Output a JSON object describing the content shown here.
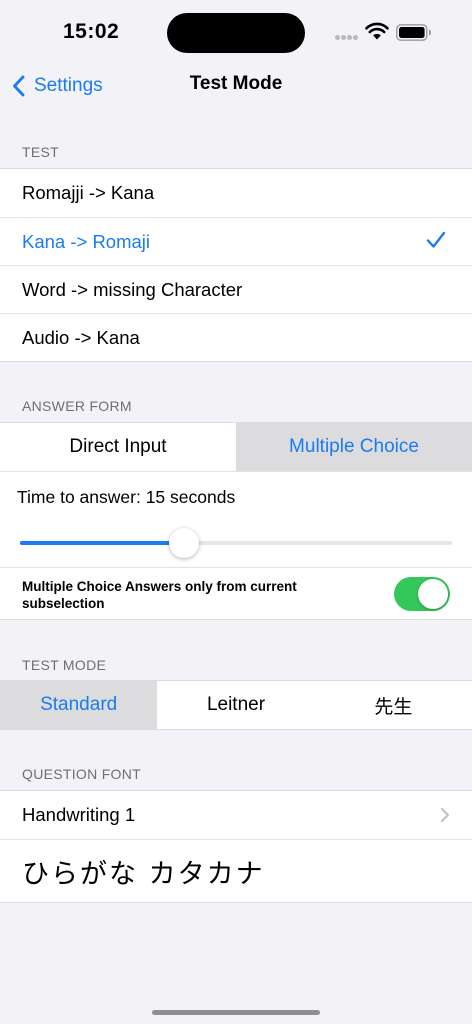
{
  "status": {
    "time": "15:02"
  },
  "nav": {
    "back_label": "Settings",
    "title": "Test Mode"
  },
  "test": {
    "header": "TEST",
    "options": [
      {
        "label": "Romajji -> Kana",
        "selected": false
      },
      {
        "label": "Kana -> Romaji",
        "selected": true
      },
      {
        "label": "Word -> missing Character",
        "selected": false
      },
      {
        "label": "Audio -> Kana",
        "selected": false
      }
    ]
  },
  "answer_form": {
    "header": "ANSWER FORM",
    "segments": [
      "Direct Input",
      "Multiple Choice"
    ],
    "selected_segment": "Multiple Choice",
    "time_label": "Time to answer: 15 seconds",
    "slider_fraction": 0.38,
    "toggle_label": "Multiple Choice Answers only from current subselection",
    "toggle_on": true
  },
  "test_mode": {
    "header": "TEST MODE",
    "segments": [
      "Standard",
      "Leitner",
      "先生"
    ],
    "selected_segment": "Standard"
  },
  "question_font": {
    "header": "QUESTION FONT",
    "selected_font": "Handwriting 1",
    "preview": "ひらがな カタカナ"
  },
  "colors": {
    "accent": "#1a7cf0",
    "toggle_on": "#34c759",
    "background": "#f2f2f7"
  }
}
